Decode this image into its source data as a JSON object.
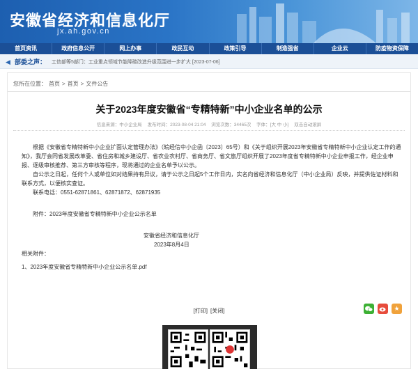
{
  "header": {
    "title": "安徽省经济和信息化厅",
    "url": "jx.ah.gov.cn"
  },
  "nav": [
    "首页资讯",
    "政府信息公开",
    "网上办事",
    "政民互动",
    "政策引导",
    "制造强省",
    "企业云",
    "防疫物资保障"
  ],
  "notice": {
    "label": "部委之声：",
    "text": "工信部等5部门：工业重点领域节能降碳改造升级范围进一步扩大 [2023-07-06]"
  },
  "breadcrumb": [
    "您所在位置：",
    "首页",
    ">",
    "首页",
    ">",
    "文件公告"
  ],
  "article": {
    "title": "关于2023年度安徽省“专精特新”中小企业名单的公示",
    "meta": {
      "source": "信息来源：中小企业局",
      "date": "发布时间：2023-08-04 21:04",
      "views": "浏览次数：34465次",
      "font": "字体：[大 中 小]",
      "read": "双击自动滚屏"
    },
    "paragraphs": [
      "根据《安徽省专精特新中小企业扩面认定管理办法》（皖经信中小企函〔2023〕65号）和《关于组织开展2023年安徽省专精特新中小企业认定工作的通知》，我厅会同省发展改革委、省住房和城乡建设厅、省农业农村厅、省商务厅、省文旅厅组织开展了2023年度省专精特新中小企业申报工作，经企业申报、逐级审核推荐、第三方审核等程序，现将通过的企业名单予以公示。",
      "自公示之日起，任何个人或单位如对结果持有异议，请于公示之日起5个工作日内，实名向省经济和信息化厅（中小企业局）反映，并提供佐证材料和联系方式，以便核实查证。",
      "联系电话：0551-62871861、62871872、62871935",
      "附件：2023年度安徽省专精特新中小企业公示名单"
    ],
    "signature_org": "安徽省经济和信息化厅",
    "signature_date": "2023年8月4日",
    "attachments_label": "相关附件：",
    "attachment_file": "1、2023年度安徽省专精特新中小企业公示名单.pdf",
    "print_label": "[打印]",
    "close_label": "[关闭]"
  },
  "share": {
    "wechat_icon": "wechat-icon",
    "weibo_icon": "weibo-icon",
    "star_icon": "star-icon",
    "colors": {
      "wechat": "#3cb034",
      "weibo": "#e74c3c",
      "star": "#f0a23b"
    }
  }
}
